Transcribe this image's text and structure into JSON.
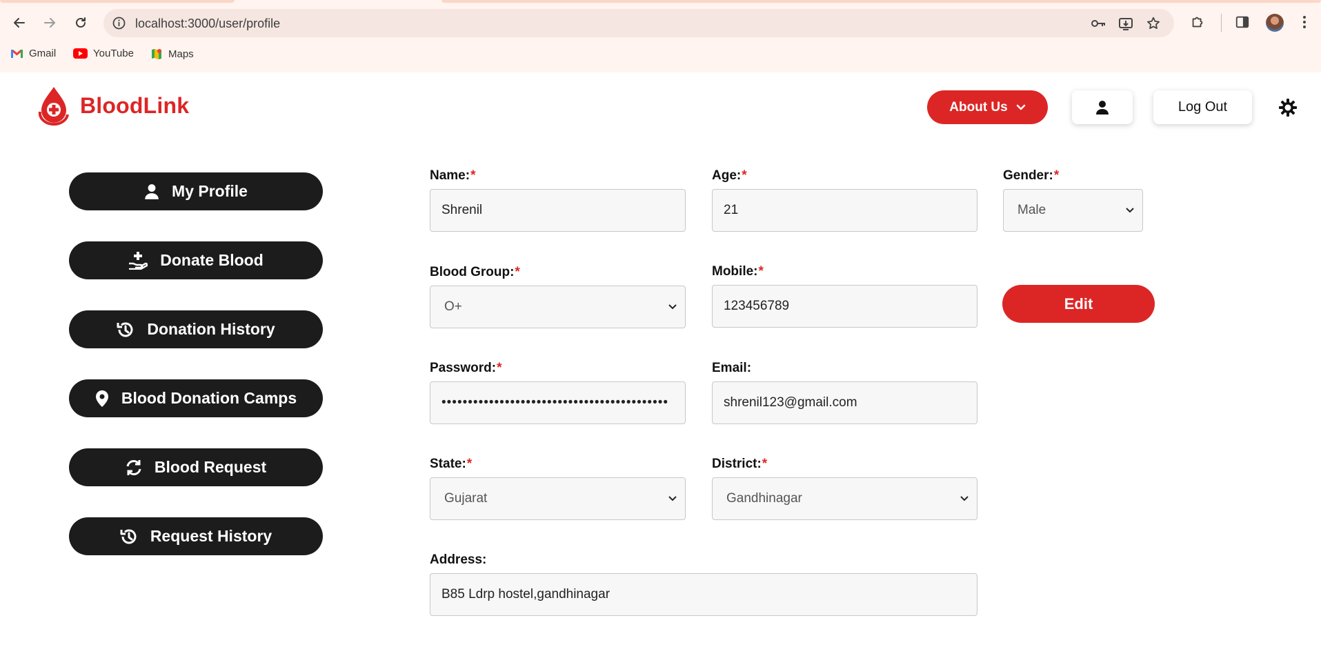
{
  "browser": {
    "url": "localhost:3000/user/profile",
    "bookmarks": [
      {
        "label": "Gmail",
        "icon": "gmail-icon"
      },
      {
        "label": "YouTube",
        "icon": "youtube-icon"
      },
      {
        "label": "Maps",
        "icon": "maps-icon"
      }
    ]
  },
  "header": {
    "brand": "BloodLink",
    "about_label": "About Us",
    "logout_label": "Log Out"
  },
  "sidebar": {
    "items": [
      {
        "label": "My Profile",
        "icon": "user-icon"
      },
      {
        "label": "Donate Blood",
        "icon": "hand-plus-icon"
      },
      {
        "label": "Donation History",
        "icon": "history-icon"
      },
      {
        "label": "Blood Donation Camps",
        "icon": "location-pin-icon"
      },
      {
        "label": "Blood Request",
        "icon": "refresh-icon"
      },
      {
        "label": "Request History",
        "icon": "history-icon"
      }
    ]
  },
  "form": {
    "name": {
      "label": "Name:",
      "value": "Shrenil",
      "required": true
    },
    "age": {
      "label": "Age:",
      "value": "21",
      "required": true
    },
    "gender": {
      "label": "Gender:",
      "value": "Male",
      "required": true
    },
    "blood_group": {
      "label": "Blood Group:",
      "value": "O+",
      "required": true
    },
    "mobile": {
      "label": "Mobile:",
      "value": "123456789",
      "required": true
    },
    "password": {
      "label": "Password:",
      "value": "•••••••••••••••••••••••••••••••••••••••••••",
      "required": true
    },
    "email": {
      "label": "Email:",
      "value": "shrenil123@gmail.com",
      "required": false
    },
    "state": {
      "label": "State:",
      "value": "Gujarat",
      "required": true
    },
    "district": {
      "label": "District:",
      "value": "Gandhinagar",
      "required": true
    },
    "address": {
      "label": "Address:",
      "value": "B85 Ldrp hostel,gandhinagar",
      "required": false
    },
    "required_marker": "*",
    "edit_label": "Edit"
  },
  "colors": {
    "accent": "#dc2626",
    "sidebar_bg": "#1c1c1c",
    "chrome_bg": "#fff4ef"
  }
}
